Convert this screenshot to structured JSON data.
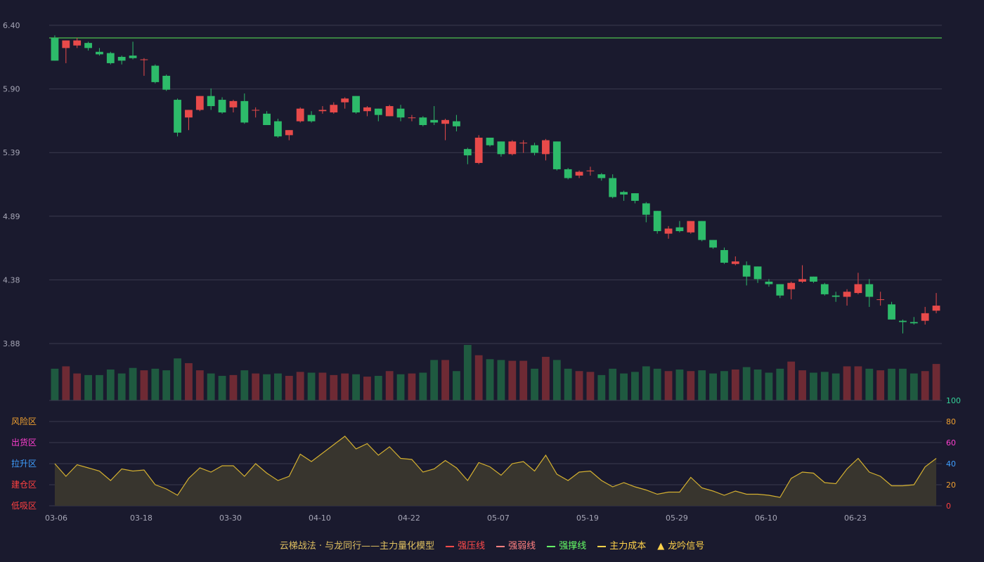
{
  "chart_data": {
    "type": "candlestick",
    "x_tick_labels": [
      "03-06",
      "03-18",
      "03-30",
      "04-10",
      "04-22",
      "05-07",
      "05-19",
      "05-29",
      "06-10",
      "06-23"
    ],
    "price_axis": {
      "ticks": [
        "6.40",
        "5.90",
        "5.39",
        "4.89",
        "4.38",
        "3.88"
      ],
      "ylim": [
        3.88,
        6.4
      ]
    },
    "reference_line": 6.3,
    "candles": [
      [
        6.3,
        6.12,
        6.32,
        6.12
      ],
      [
        6.22,
        6.28,
        6.28,
        6.1
      ],
      [
        6.24,
        6.28,
        6.3,
        6.22
      ],
      [
        6.26,
        6.22,
        6.27,
        6.2
      ],
      [
        6.19,
        6.17,
        6.22,
        6.16
      ],
      [
        6.18,
        6.1,
        6.19,
        6.09
      ],
      [
        6.15,
        6.12,
        6.16,
        6.09
      ],
      [
        6.16,
        6.14,
        6.27,
        6.13
      ],
      [
        6.13,
        6.13,
        6.14,
        6.0
      ],
      [
        6.08,
        5.95,
        6.09,
        5.94
      ],
      [
        6.0,
        5.89,
        6.01,
        5.88
      ],
      [
        5.81,
        5.55,
        5.82,
        5.52
      ],
      [
        5.67,
        5.73,
        5.73,
        5.57
      ],
      [
        5.73,
        5.84,
        5.84,
        5.72
      ],
      [
        5.84,
        5.76,
        5.9,
        5.73
      ],
      [
        5.81,
        5.71,
        5.83,
        5.7
      ],
      [
        5.75,
        5.8,
        5.81,
        5.71
      ],
      [
        5.8,
        5.63,
        5.86,
        5.62
      ],
      [
        5.73,
        5.73,
        5.75,
        5.67
      ],
      [
        5.7,
        5.61,
        5.72,
        5.61
      ],
      [
        5.64,
        5.52,
        5.66,
        5.51
      ],
      [
        5.53,
        5.57,
        5.57,
        5.49
      ],
      [
        5.64,
        5.74,
        5.75,
        5.63
      ],
      [
        5.69,
        5.64,
        5.72,
        5.63
      ],
      [
        5.72,
        5.73,
        5.76,
        5.7
      ],
      [
        5.71,
        5.77,
        5.79,
        5.7
      ],
      [
        5.79,
        5.82,
        5.83,
        5.74
      ],
      [
        5.84,
        5.71,
        5.84,
        5.7
      ],
      [
        5.72,
        5.75,
        5.76,
        5.68
      ],
      [
        5.74,
        5.69,
        5.74,
        5.64
      ],
      [
        5.68,
        5.76,
        5.77,
        5.68
      ],
      [
        5.74,
        5.67,
        5.77,
        5.64
      ],
      [
        5.67,
        5.67,
        5.69,
        5.64
      ],
      [
        5.67,
        5.61,
        5.68,
        5.6
      ],
      [
        5.65,
        5.63,
        5.76,
        5.61
      ],
      [
        5.62,
        5.65,
        5.66,
        5.49
      ],
      [
        5.64,
        5.6,
        5.69,
        5.56
      ],
      [
        5.42,
        5.37,
        5.43,
        5.3
      ],
      [
        5.31,
        5.51,
        5.53,
        5.3
      ],
      [
        5.51,
        5.45,
        5.51,
        5.44
      ],
      [
        5.48,
        5.38,
        5.48,
        5.36
      ],
      [
        5.38,
        5.48,
        5.49,
        5.37
      ],
      [
        5.47,
        5.47,
        5.49,
        5.39
      ],
      [
        5.45,
        5.39,
        5.47,
        5.37
      ],
      [
        5.38,
        5.49,
        5.5,
        5.33
      ],
      [
        5.48,
        5.26,
        5.48,
        5.25
      ],
      [
        5.26,
        5.19,
        5.27,
        5.18
      ],
      [
        5.21,
        5.24,
        5.25,
        5.19
      ],
      [
        5.25,
        5.25,
        5.28,
        5.21
      ],
      [
        5.22,
        5.19,
        5.23,
        5.17
      ],
      [
        5.19,
        5.04,
        5.22,
        5.03
      ],
      [
        5.08,
        5.06,
        5.09,
        5.01
      ],
      [
        5.07,
        5.01,
        5.07,
        4.99
      ],
      [
        4.99,
        4.9,
        5.0,
        4.84
      ],
      [
        4.93,
        4.77,
        4.93,
        4.75
      ],
      [
        4.75,
        4.79,
        4.81,
        4.71
      ],
      [
        4.8,
        4.77,
        4.85,
        4.76
      ],
      [
        4.76,
        4.85,
        4.85,
        4.75
      ],
      [
        4.85,
        4.7,
        4.85,
        4.69
      ],
      [
        4.7,
        4.64,
        4.7,
        4.63
      ],
      [
        4.62,
        4.52,
        4.64,
        4.51
      ],
      [
        4.51,
        4.53,
        4.57,
        4.5
      ],
      [
        4.5,
        4.41,
        4.53,
        4.34
      ],
      [
        4.49,
        4.39,
        4.49,
        4.36
      ],
      [
        4.37,
        4.35,
        4.39,
        4.33
      ],
      [
        4.35,
        4.26,
        4.35,
        4.24
      ],
      [
        4.31,
        4.36,
        4.37,
        4.23
      ],
      [
        4.37,
        4.39,
        4.5,
        4.36
      ],
      [
        4.41,
        4.37,
        4.41,
        4.36
      ],
      [
        4.35,
        4.27,
        4.36,
        4.26
      ],
      [
        4.26,
        4.25,
        4.29,
        4.21
      ],
      [
        4.25,
        4.29,
        4.31,
        4.18
      ],
      [
        4.28,
        4.35,
        4.44,
        4.27
      ],
      [
        4.35,
        4.25,
        4.39,
        4.17
      ],
      [
        4.23,
        4.23,
        4.29,
        4.18
      ],
      [
        4.19,
        4.07,
        4.21,
        4.07
      ],
      [
        4.06,
        4.05,
        4.07,
        3.96
      ],
      [
        4.05,
        4.04,
        4.09,
        4.03
      ],
      [
        4.06,
        4.12,
        4.17,
        4.03
      ],
      [
        4.14,
        4.18,
        4.28,
        4.12
      ]
    ],
    "volume": [
      40,
      43,
      34,
      32,
      32,
      39,
      34,
      41,
      38,
      40,
      38,
      53,
      47,
      38,
      34,
      31,
      32,
      38,
      34,
      33,
      34,
      31,
      36,
      35,
      35,
      32,
      34,
      33,
      30,
      31,
      37,
      33,
      34,
      35,
      51,
      51,
      37,
      70,
      57,
      52,
      51,
      50,
      50,
      40,
      55,
      51,
      40,
      37,
      36,
      32,
      40,
      34,
      36,
      43,
      40,
      37,
      39,
      37,
      38,
      34,
      37,
      39,
      42,
      39,
      35,
      40,
      49,
      38,
      35,
      36,
      34,
      43,
      43,
      40,
      38,
      40,
      40,
      34,
      37,
      46
    ],
    "indicator": {
      "ticks": [
        "100",
        "80",
        "60",
        "40",
        "20",
        "0"
      ],
      "tick_colors": [
        "#34d399",
        "#f0a030",
        "#ff3fd0",
        "#3f9fff",
        "#f0a030",
        "#ff4040"
      ],
      "ylim": [
        0,
        100
      ],
      "zones": [
        {
          "label": "风险区",
          "color": "#f0a030"
        },
        {
          "label": "出货区",
          "color": "#ff3fd0"
        },
        {
          "label": "拉升区",
          "color": "#3f9fff"
        },
        {
          "label": "建仓区",
          "color": "#ff4040"
        },
        {
          "label": "低吸区",
          "color": "#ff4040"
        }
      ],
      "values": [
        40,
        28,
        39,
        36,
        33,
        24,
        35,
        33,
        34,
        20,
        16,
        10,
        26,
        36,
        32,
        38,
        38,
        28,
        40,
        31,
        24,
        28,
        49,
        42,
        50,
        58,
        66,
        54,
        59,
        48,
        56,
        45,
        44,
        32,
        35,
        43,
        36,
        24,
        41,
        37,
        29,
        40,
        42,
        33,
        48,
        30,
        24,
        32,
        33,
        24,
        18,
        22,
        18,
        15,
        11,
        13,
        13,
        27,
        17,
        14,
        10,
        14,
        11,
        11,
        10,
        8,
        26,
        32,
        31,
        22,
        21,
        35,
        45,
        32,
        28,
        19,
        19,
        20,
        37,
        45
      ]
    },
    "legend": [
      {
        "label": "云梯战法 · 与龙同行——主力量化模型",
        "marker": "none",
        "color": "#e0c060"
      },
      {
        "label": "强压线",
        "marker": "solid",
        "color": "#ff4a4a"
      },
      {
        "label": "强弱线",
        "marker": "dashed",
        "color": "#ff8080"
      },
      {
        "label": "强撑线",
        "marker": "solid",
        "color": "#66ff66"
      },
      {
        "label": "主力成本",
        "marker": "dashed",
        "color": "#ffd24a"
      },
      {
        "label": "龙吟信号",
        "marker": "triangle",
        "color": "#ffd24a"
      }
    ]
  },
  "colors": {
    "up": "#e84a4a",
    "down": "#2dbb6a",
    "up_volume": "#6e2a34",
    "down_volume": "#1f5a40",
    "grid": "#3a3a4e",
    "axis_text": "#a6a6b6",
    "reference_line": "#4ec04e",
    "indicator_line": "#d4b030",
    "indicator_fill": "#38352e"
  }
}
